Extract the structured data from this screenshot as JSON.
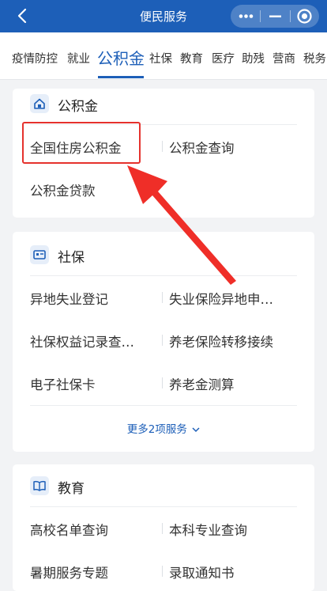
{
  "header": {
    "title": "便民服务"
  },
  "tabs": [
    "疫情防控",
    "就业",
    "公积金",
    "社保",
    "教育",
    "医疗",
    "助残",
    "营商",
    "税务"
  ],
  "sections": {
    "housing_fund": {
      "title": "公积金",
      "icon": "house-icon",
      "items": [
        "全国住房公积金",
        "公积金查询",
        "公积金贷款"
      ]
    },
    "social_security": {
      "title": "社保",
      "icon": "id-card-icon",
      "items": [
        "异地失业登记",
        "失业保险异地申…",
        "社保权益记录查…",
        "养老保险转移接续",
        "电子社保卡",
        "养老金测算"
      ],
      "more": "更多2项服务"
    },
    "education": {
      "title": "教育",
      "icon": "book-icon",
      "items": [
        "高校名单查询",
        "本科专业查询",
        "暑期服务专题",
        "录取通知书"
      ]
    }
  },
  "colors": {
    "primary": "#1d5fb8",
    "highlight": "#e5322d",
    "background": "#f2f3f5"
  }
}
